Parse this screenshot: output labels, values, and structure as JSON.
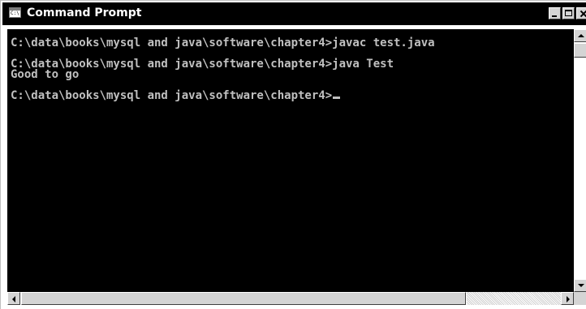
{
  "window": {
    "title": "Command Prompt",
    "icon": "console-app-icon",
    "icon_glyph": "C:\\"
  },
  "controls": {
    "minimize": "minimize-icon",
    "maximize": "maximize-icon",
    "close": "close-icon"
  },
  "console": {
    "lines": [
      "C:\\data\\books\\mysql and java\\software\\chapter4>javac test.java",
      "",
      "C:\\data\\books\\mysql and java\\software\\chapter4>java Test",
      "Good to go",
      "",
      "C:\\data\\books\\mysql and java\\software\\chapter4>"
    ]
  },
  "colors": {
    "titlebar": "#000000",
    "console_background": "#000000",
    "console_text": "#c0c0c0"
  }
}
